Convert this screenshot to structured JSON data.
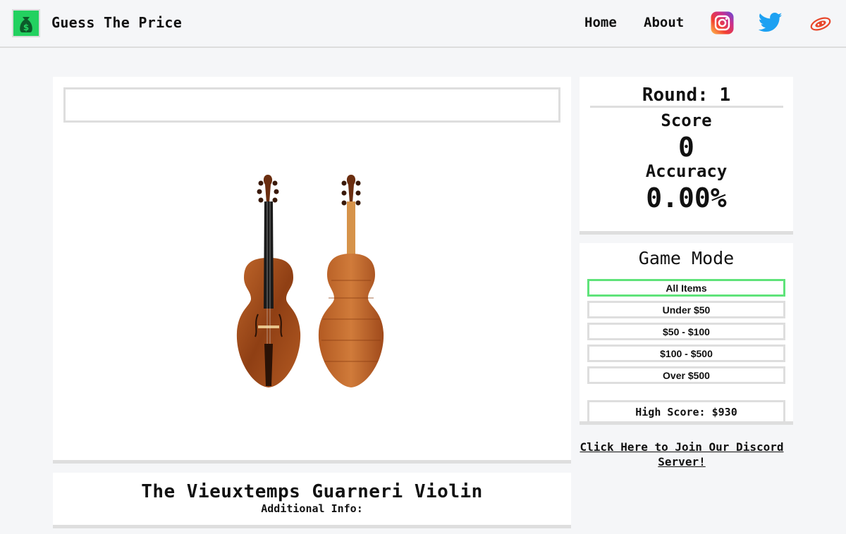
{
  "header": {
    "title": "Guess The Price",
    "logo_icon": "money-bag-icon",
    "nav": {
      "home": "Home",
      "about": "About"
    },
    "social": [
      "instagram-icon",
      "twitter-icon",
      "reddit-icon"
    ]
  },
  "game": {
    "guess_input": {
      "value": "",
      "placeholder": ""
    },
    "item": {
      "name": "The Vieuxtemps Guarneri Violin",
      "additional_info_label": "Additional Info:"
    }
  },
  "stats": {
    "round_label": "Round: 1",
    "score_label": "Score",
    "score_value": "0",
    "accuracy_label": "Accuracy",
    "accuracy_value": "0.00%"
  },
  "game_mode": {
    "title": "Game Mode",
    "options": [
      "All Items",
      "Under $50",
      "$50 - $100",
      "$100 - $500",
      "Over $500"
    ],
    "selected": "All Items",
    "high_score": "High Score: $930"
  },
  "discord_link": "Click Here to Join Our Discord Server!",
  "colors": {
    "selected_border": "#5fe37a",
    "card_border": "#dedede",
    "background": "#f5f6f8"
  }
}
